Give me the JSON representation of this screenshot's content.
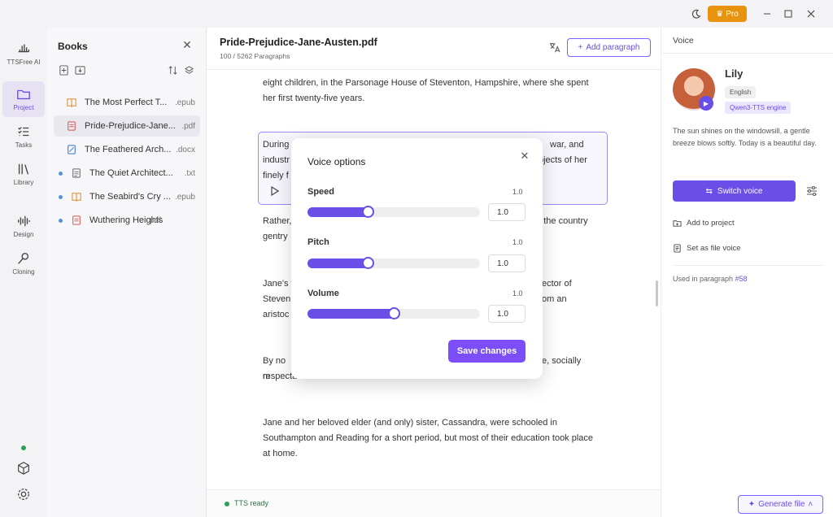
{
  "window": {
    "pro_label": "Pro"
  },
  "rail": {
    "brand": "TTSFree AI",
    "items": [
      "Project",
      "Tasks",
      "Library",
      "Design",
      "Cloning"
    ]
  },
  "books": {
    "title": "Books",
    "items": [
      {
        "name": "The Most Perfect T...",
        "ext": ".epub",
        "dot": false
      },
      {
        "name": "Pride-Prejudice-Jane...",
        "ext": ".pdf",
        "dot": false
      },
      {
        "name": "The Feathered Arch...",
        "ext": ".docx",
        "dot": false
      },
      {
        "name": "The Quiet Architect...",
        "ext": ".txt",
        "dot": true
      },
      {
        "name": "The Seabird's Cry ...",
        "ext": ".epub",
        "dot": true
      },
      {
        "name": "Wuthering Heights",
        "ext": ".pdf",
        "dot": true
      }
    ]
  },
  "main": {
    "title": "Pride-Prejudice-Jane-Austen.pdf",
    "subtitle": "100 / 5262 Paragraphs",
    "add_paragraph": "Add paragraph",
    "paragraphs": {
      "p1": "eight children, in the Parsonage House of Steventon, Hampshire, where she spent her first twenty-five years.",
      "p2a": "During",
      "p2b": "war, and",
      "p2c": "industr",
      "p2d": "bjects of her",
      "p2e": "finely f",
      "p3a": "Rather,",
      "p3b": "of the country",
      "p3c": "gentry",
      "p4a": "Jane's f",
      "p4b": "ector of",
      "p4c": "Steven",
      "p4d": "om an",
      "p4e": "aristoc",
      "p5a": "By no m",
      "p5b": "e, socially",
      "p5c": "respecta",
      "p6": "Jane and her beloved elder (and only) sister, Cassandra, were schooled in Southampton and Reading for a short period, but most of their education took place at home."
    },
    "status": "TTS ready"
  },
  "voice": {
    "header": "Voice",
    "name": "Lily",
    "language": "English",
    "engine": "Qwen3-TTS engine",
    "description": "The sun shines on the windowsill, a gentle breeze blows softly. Today is a beautiful day.",
    "switch_label": "Switch voice",
    "add_to_project": "Add to project",
    "set_file_voice": "Set as file voice",
    "used_in_prefix": "Used in paragraph",
    "used_in_link": "#58",
    "generate_label": "Generate file"
  },
  "modal": {
    "title": "Voice options",
    "save_label": "Save changes",
    "rows": [
      {
        "label": "Speed",
        "max": "1.0",
        "value": "1.0",
        "level": 0.35
      },
      {
        "label": "Pitch",
        "max": "1.0",
        "value": "1.0",
        "level": 0.35
      },
      {
        "label": "Volume",
        "max": "1.0",
        "value": "1.0",
        "level": 0.5
      }
    ]
  },
  "colors": {
    "accent": "#6a4ee8",
    "pro": "#e8930f",
    "ready": "#2e9e57"
  }
}
